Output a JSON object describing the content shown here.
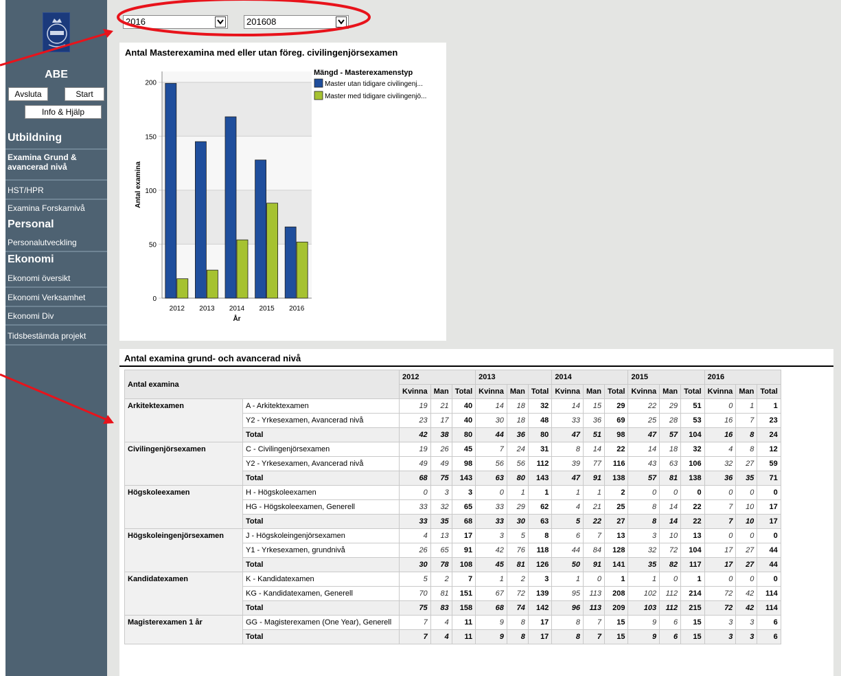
{
  "sidebar": {
    "org": "ABE",
    "buttons": {
      "quit": "Avsluta",
      "start": "Start",
      "help": "Info & Hjälp"
    },
    "sections": [
      {
        "heading": "Utbildning",
        "items": [
          "Examina Grund & avancerad nivå",
          "HST/HPR",
          "Examina Forskarnivå"
        ]
      },
      {
        "heading": "Personal",
        "items": [
          "Personalutveckling"
        ]
      },
      {
        "heading": "Ekonomi",
        "items": [
          "Ekonomi översikt",
          "Ekonomi Verksamhet",
          "Ekonomi Div",
          "Tidsbestämda projekt"
        ]
      }
    ]
  },
  "filters": {
    "year": "2016",
    "period": "201608"
  },
  "chart": {
    "title": "Antal Masterexamina med eller utan föreg. civilingenjörsexamen",
    "legend_title": "Mängd - Masterexamenstyp",
    "xlabel": "År",
    "ylabel": "Antal examina"
  },
  "chart_data": {
    "type": "bar",
    "categories": [
      "2012",
      "2013",
      "2014",
      "2015",
      "2016"
    ],
    "series": [
      {
        "name": "Master utan tidigare civilingenj...",
        "color": "#1f4e9c",
        "values": [
          199,
          145,
          168,
          128,
          66
        ]
      },
      {
        "name": "Master med tidigare civilingenjö...",
        "color": "#a6c231",
        "values": [
          18,
          26,
          54,
          88,
          52
        ]
      }
    ],
    "yticks": [
      0,
      50,
      100,
      150,
      200
    ],
    "ylim": [
      0,
      210
    ],
    "grid": true,
    "legend": "right"
  },
  "table": {
    "title": "Antal examina grund- och avancerad nivå",
    "corner": "Antal examina",
    "years": [
      "2012",
      "2013",
      "2014",
      "2015",
      "2016"
    ],
    "subheaders": [
      "Kvinna",
      "Man",
      "Total"
    ],
    "total_label": "Total",
    "groups": [
      {
        "name": "Arkitektexamen",
        "rows": [
          {
            "label": "A - Arkitektexamen",
            "vals": [
              [
                19,
                21,
                40
              ],
              [
                14,
                18,
                32
              ],
              [
                14,
                15,
                29
              ],
              [
                22,
                29,
                51
              ],
              [
                0,
                1,
                1
              ]
            ]
          },
          {
            "label": "Y2 - Yrkesexamen, Avancerad nivå",
            "vals": [
              [
                23,
                17,
                40
              ],
              [
                30,
                18,
                48
              ],
              [
                33,
                36,
                69
              ],
              [
                25,
                28,
                53
              ],
              [
                16,
                7,
                23
              ]
            ]
          }
        ],
        "total": [
          [
            42,
            38,
            80
          ],
          [
            44,
            36,
            80
          ],
          [
            47,
            51,
            98
          ],
          [
            47,
            57,
            104
          ],
          [
            16,
            8,
            24
          ]
        ]
      },
      {
        "name": "Civilingenjörsexamen",
        "rows": [
          {
            "label": "C - Civilingenjörsexamen",
            "vals": [
              [
                19,
                26,
                45
              ],
              [
                7,
                24,
                31
              ],
              [
                8,
                14,
                22
              ],
              [
                14,
                18,
                32
              ],
              [
                4,
                8,
                12
              ]
            ]
          },
          {
            "label": "Y2 - Yrkesexamen, Avancerad nivå",
            "vals": [
              [
                49,
                49,
                98
              ],
              [
                56,
                56,
                112
              ],
              [
                39,
                77,
                116
              ],
              [
                43,
                63,
                106
              ],
              [
                32,
                27,
                59
              ]
            ]
          }
        ],
        "total": [
          [
            68,
            75,
            143
          ],
          [
            63,
            80,
            143
          ],
          [
            47,
            91,
            138
          ],
          [
            57,
            81,
            138
          ],
          [
            36,
            35,
            71
          ]
        ]
      },
      {
        "name": "Högskoleexamen",
        "rows": [
          {
            "label": "H - Högskoleexamen",
            "vals": [
              [
                0,
                3,
                3
              ],
              [
                0,
                1,
                1
              ],
              [
                1,
                1,
                2
              ],
              [
                0,
                0,
                0
              ],
              [
                0,
                0,
                0
              ]
            ]
          },
          {
            "label": "HG - Högskoleexamen, Generell",
            "vals": [
              [
                33,
                32,
                65
              ],
              [
                33,
                29,
                62
              ],
              [
                4,
                21,
                25
              ],
              [
                8,
                14,
                22
              ],
              [
                7,
                10,
                17
              ]
            ]
          }
        ],
        "total": [
          [
            33,
            35,
            68
          ],
          [
            33,
            30,
            63
          ],
          [
            5,
            22,
            27
          ],
          [
            8,
            14,
            22
          ],
          [
            7,
            10,
            17
          ]
        ]
      },
      {
        "name": "Högskoleingenjörsexamen",
        "rows": [
          {
            "label": "J - Högskoleingenjörsexamen",
            "vals": [
              [
                4,
                13,
                17
              ],
              [
                3,
                5,
                8
              ],
              [
                6,
                7,
                13
              ],
              [
                3,
                10,
                13
              ],
              [
                0,
                0,
                0
              ]
            ]
          },
          {
            "label": "Y1 - Yrkesexamen, grundnivå",
            "vals": [
              [
                26,
                65,
                91
              ],
              [
                42,
                76,
                118
              ],
              [
                44,
                84,
                128
              ],
              [
                32,
                72,
                104
              ],
              [
                17,
                27,
                44
              ]
            ]
          }
        ],
        "total": [
          [
            30,
            78,
            108
          ],
          [
            45,
            81,
            126
          ],
          [
            50,
            91,
            141
          ],
          [
            35,
            82,
            117
          ],
          [
            17,
            27,
            44
          ]
        ]
      },
      {
        "name": "Kandidatexamen",
        "rows": [
          {
            "label": "K - Kandidatexamen",
            "vals": [
              [
                5,
                2,
                7
              ],
              [
                1,
                2,
                3
              ],
              [
                1,
                0,
                1
              ],
              [
                1,
                0,
                1
              ],
              [
                0,
                0,
                0
              ]
            ]
          },
          {
            "label": "KG - Kandidatexamen, Generell",
            "vals": [
              [
                70,
                81,
                151
              ],
              [
                67,
                72,
                139
              ],
              [
                95,
                113,
                208
              ],
              [
                102,
                112,
                214
              ],
              [
                72,
                42,
                114
              ]
            ]
          }
        ],
        "total": [
          [
            75,
            83,
            158
          ],
          [
            68,
            74,
            142
          ],
          [
            96,
            113,
            209
          ],
          [
            103,
            112,
            215
          ],
          [
            72,
            42,
            114
          ]
        ]
      },
      {
        "name": "Magisterexamen 1 år",
        "rows": [
          {
            "label": "GG - Magisterexamen (One Year), Generell",
            "vals": [
              [
                7,
                4,
                11
              ],
              [
                9,
                8,
                17
              ],
              [
                8,
                7,
                15
              ],
              [
                9,
                6,
                15
              ],
              [
                3,
                3,
                6
              ]
            ]
          }
        ],
        "total": [
          [
            7,
            4,
            11
          ],
          [
            9,
            8,
            17
          ],
          [
            8,
            7,
            15
          ],
          [
            9,
            6,
            15
          ],
          [
            3,
            3,
            6
          ]
        ]
      }
    ]
  },
  "colors": {
    "sidebar": "#4e6272",
    "annotation": "#e8131b",
    "bar_blue": "#1f4e9c",
    "bar_green": "#a6c231"
  }
}
